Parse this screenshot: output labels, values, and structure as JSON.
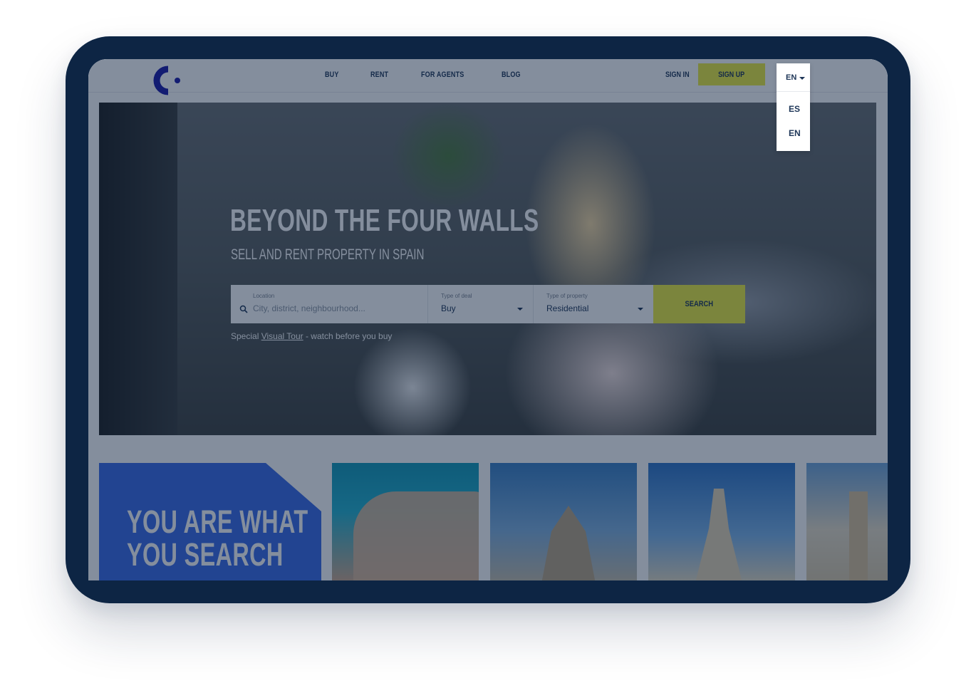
{
  "header": {
    "nav": [
      "BUY",
      "RENT",
      "FOR AGENTS",
      "BLOG"
    ],
    "sign_in": "SIGN IN",
    "sign_up": "SIGN UP",
    "language_current": "EN",
    "language_options": [
      "ES",
      "EN"
    ]
  },
  "hero": {
    "title": "BEYOND THE FOUR WALLS",
    "subtitle": "SELL AND RENT PROPERTY IN SPAIN",
    "search": {
      "location_label": "Location",
      "location_placeholder": "City, district, neighbourhood...",
      "deal_label": "Type of deal",
      "deal_value": "Buy",
      "property_label": "Type of property",
      "property_value": "Residential",
      "button": "SEARCH"
    },
    "hint_prefix": "Special ",
    "hint_link": "Visual Tour",
    "hint_suffix": " - watch before you buy"
  },
  "promo": {
    "line1": "YOU ARE WHAT",
    "line2": "YOU SEARCH"
  },
  "colors": {
    "frame": "#0d2544",
    "accent": "#ecec3f",
    "brand": "#1d3557",
    "promo": "#3a6be6"
  },
  "icons": [
    "logo-icon",
    "search-icon",
    "chevron-down-icon"
  ]
}
